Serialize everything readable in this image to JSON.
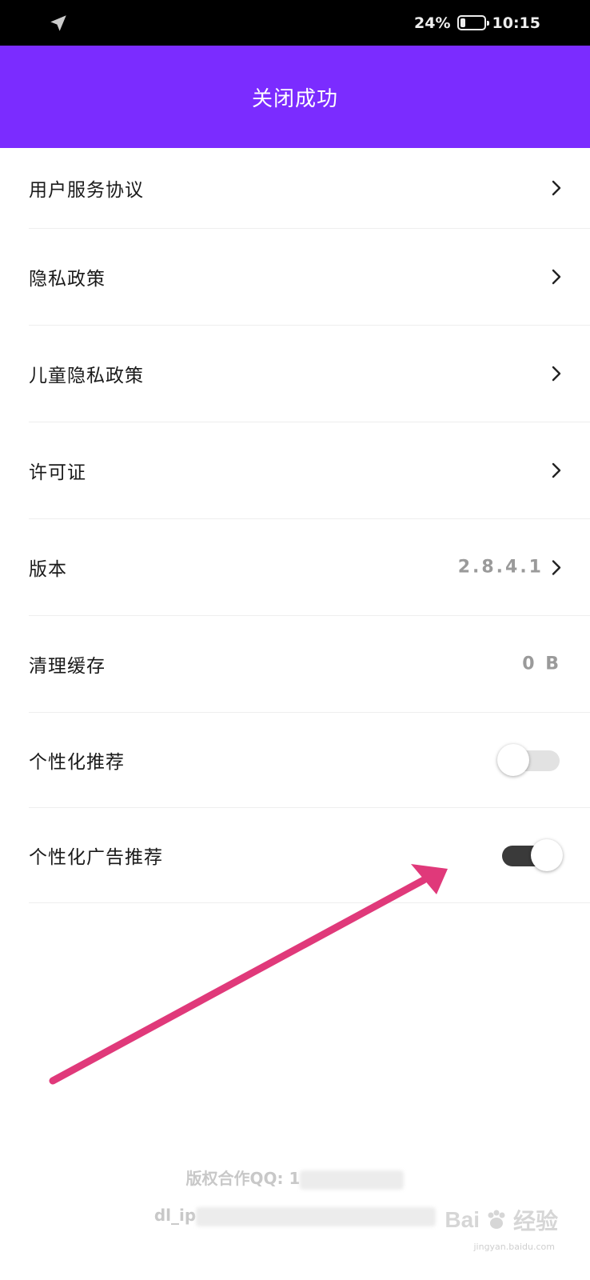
{
  "status_bar": {
    "battery_text": "24%",
    "battery_level": 0.24,
    "time": "10:15",
    "location_icon": "location-arrow-icon"
  },
  "header": {
    "title": "关闭成功",
    "background": "#7b2cff"
  },
  "settings": {
    "items": [
      {
        "label": "用户服务协议"
      },
      {
        "label": "隐私政策"
      },
      {
        "label": "儿童隐私政策"
      },
      {
        "label": "许可证"
      },
      {
        "label": "版本",
        "value": "2.8.4.1"
      },
      {
        "label": "清理缓存",
        "value": "0 B"
      },
      {
        "label": "个性化推荐",
        "toggle_on": false
      },
      {
        "label": "个性化广告推荐",
        "toggle_on": true
      }
    ]
  },
  "footer": {
    "copyright_prefix": "版权合作QQ: 1",
    "line2_prefix": "dl_ip"
  },
  "watermark": {
    "brand": "Bai",
    "brand_suffix": "经验",
    "url": "jingyan.baidu.com"
  },
  "colors": {
    "accent": "#7b2cff",
    "arrow": "#e0397a",
    "toggle_on": "#3a3a3a",
    "toggle_off": "#e2e2e2"
  }
}
